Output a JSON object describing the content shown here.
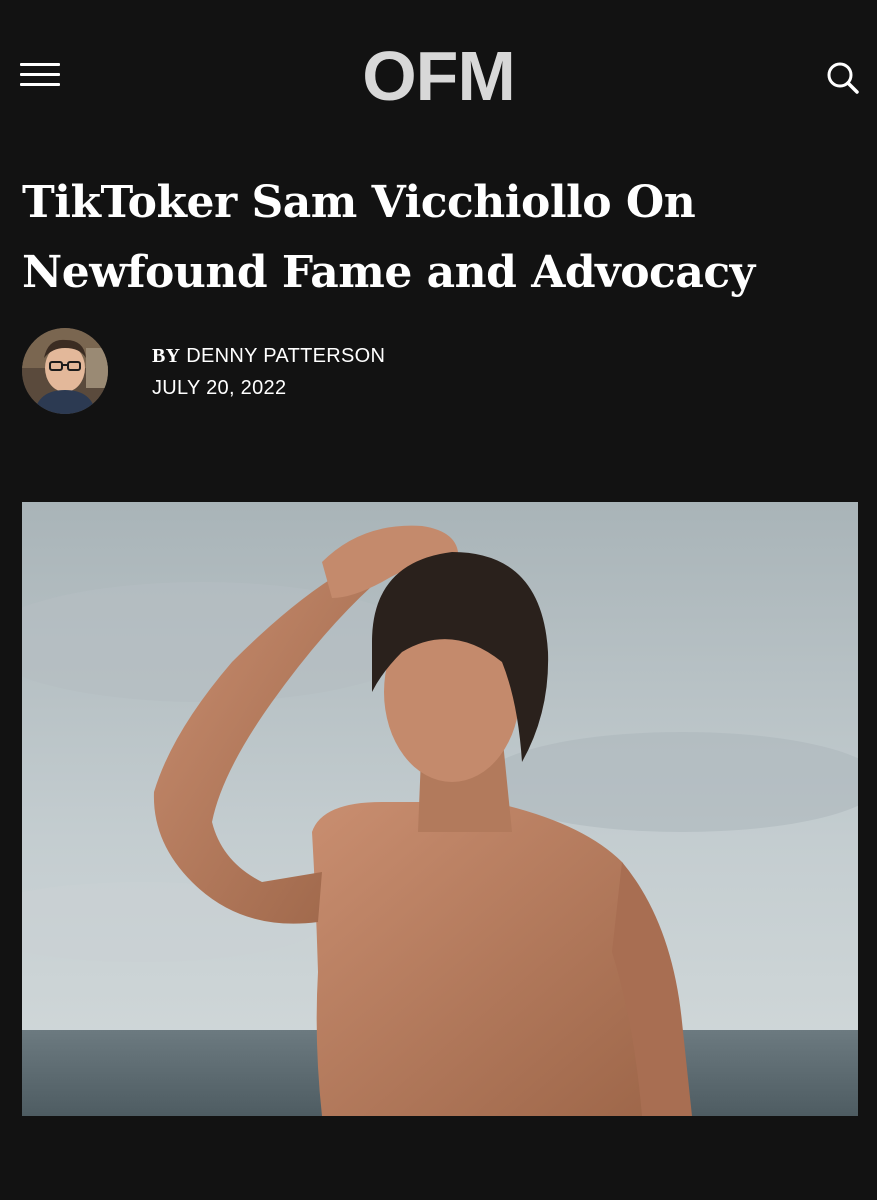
{
  "header": {
    "logo_text": "OFM",
    "menu_icon": "hamburger-menu-icon",
    "search_icon": "search-icon"
  },
  "article": {
    "title": "TikToker Sam Vicchiollo On Newfound Fame and Advocacy",
    "byline_prefix": "BY",
    "author": "DENNY PATTERSON",
    "date": "JULY 20, 2022"
  },
  "colors": {
    "background": "#121212",
    "text": "#ffffff",
    "logo": "#d8d8d8"
  }
}
